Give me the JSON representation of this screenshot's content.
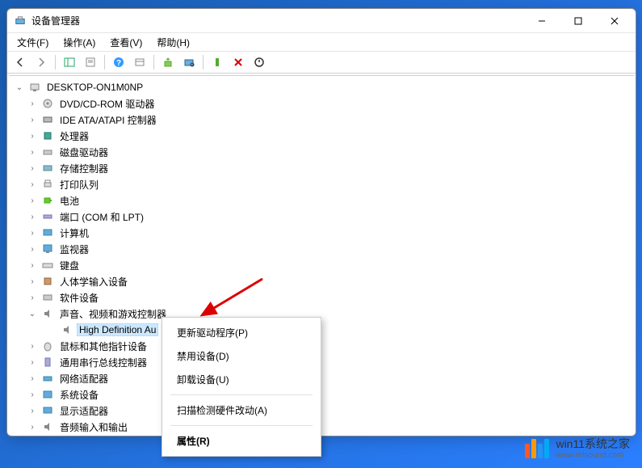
{
  "window": {
    "title": "设备管理器"
  },
  "menubar": {
    "file": "文件(F)",
    "action": "操作(A)",
    "view": "查看(V)",
    "help": "帮助(H)"
  },
  "tree": {
    "root": "DESKTOP-ON1M0NP",
    "items": [
      "DVD/CD-ROM 驱动器",
      "IDE ATA/ATAPI 控制器",
      "处理器",
      "磁盘驱动器",
      "存储控制器",
      "打印队列",
      "电池",
      "端口 (COM 和 LPT)",
      "计算机",
      "监视器",
      "键盘",
      "人体学输入设备",
      "软件设备",
      "声音、视频和游戏控制器",
      "鼠标和其他指针设备",
      "通用串行总线控制器",
      "网络适配器",
      "系统设备",
      "显示适配器",
      "音频输入和输出"
    ],
    "selected_child": "High Definition Au"
  },
  "context_menu": {
    "update_driver": "更新驱动程序(P)",
    "disable_device": "禁用设备(D)",
    "uninstall_device": "卸载设备(U)",
    "scan_hardware": "扫描检测硬件改动(A)",
    "properties": "属性(R)"
  },
  "watermark": {
    "title": "win11系统之家",
    "url": "www.relsound.com"
  }
}
